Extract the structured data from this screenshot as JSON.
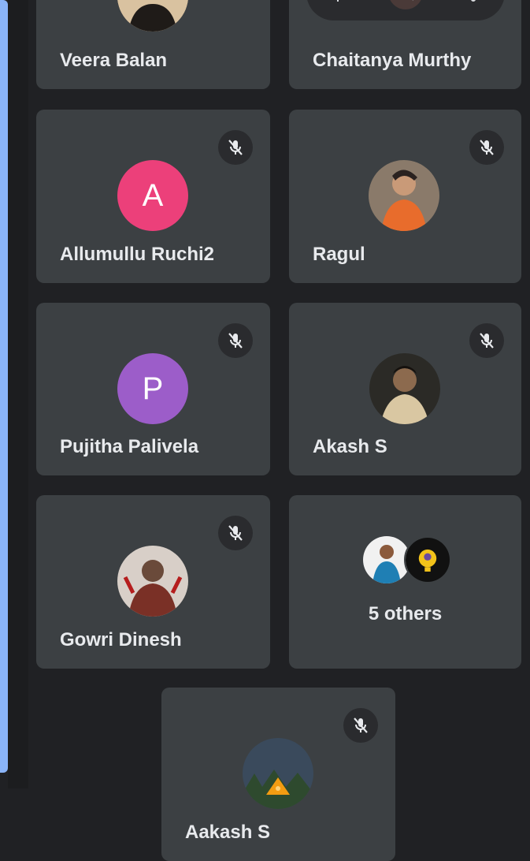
{
  "participants": [
    {
      "name": "Veera Balan",
      "muted": false,
      "avatar": "photo"
    },
    {
      "name": "Chaitanya Murthy",
      "muted": false,
      "avatar": "photo"
    },
    {
      "name": "Allumullu Ruchi2",
      "muted": true,
      "avatar": "initial",
      "initial": "A",
      "color": "#ec407a"
    },
    {
      "name": "Ragul",
      "muted": true,
      "avatar": "photo"
    },
    {
      "name": "Pujitha Palivela",
      "muted": true,
      "avatar": "initial",
      "initial": "P",
      "color": "#9c5dc9"
    },
    {
      "name": "Akash S",
      "muted": true,
      "avatar": "photo"
    },
    {
      "name": "Gowri Dinesh",
      "muted": true,
      "avatar": "photo"
    },
    {
      "name": "Aakash S",
      "muted": true,
      "avatar": "photo"
    }
  ],
  "others": {
    "label": "5 others"
  },
  "tile_toolbar": {
    "icons": [
      "pin-icon",
      "frame-icon",
      "more-vert-icon"
    ]
  },
  "icons": {
    "mute": "mic-off-icon"
  },
  "colors": {
    "background": "#202124",
    "tile": "#3c4043",
    "accent": "#8ab4f8"
  }
}
